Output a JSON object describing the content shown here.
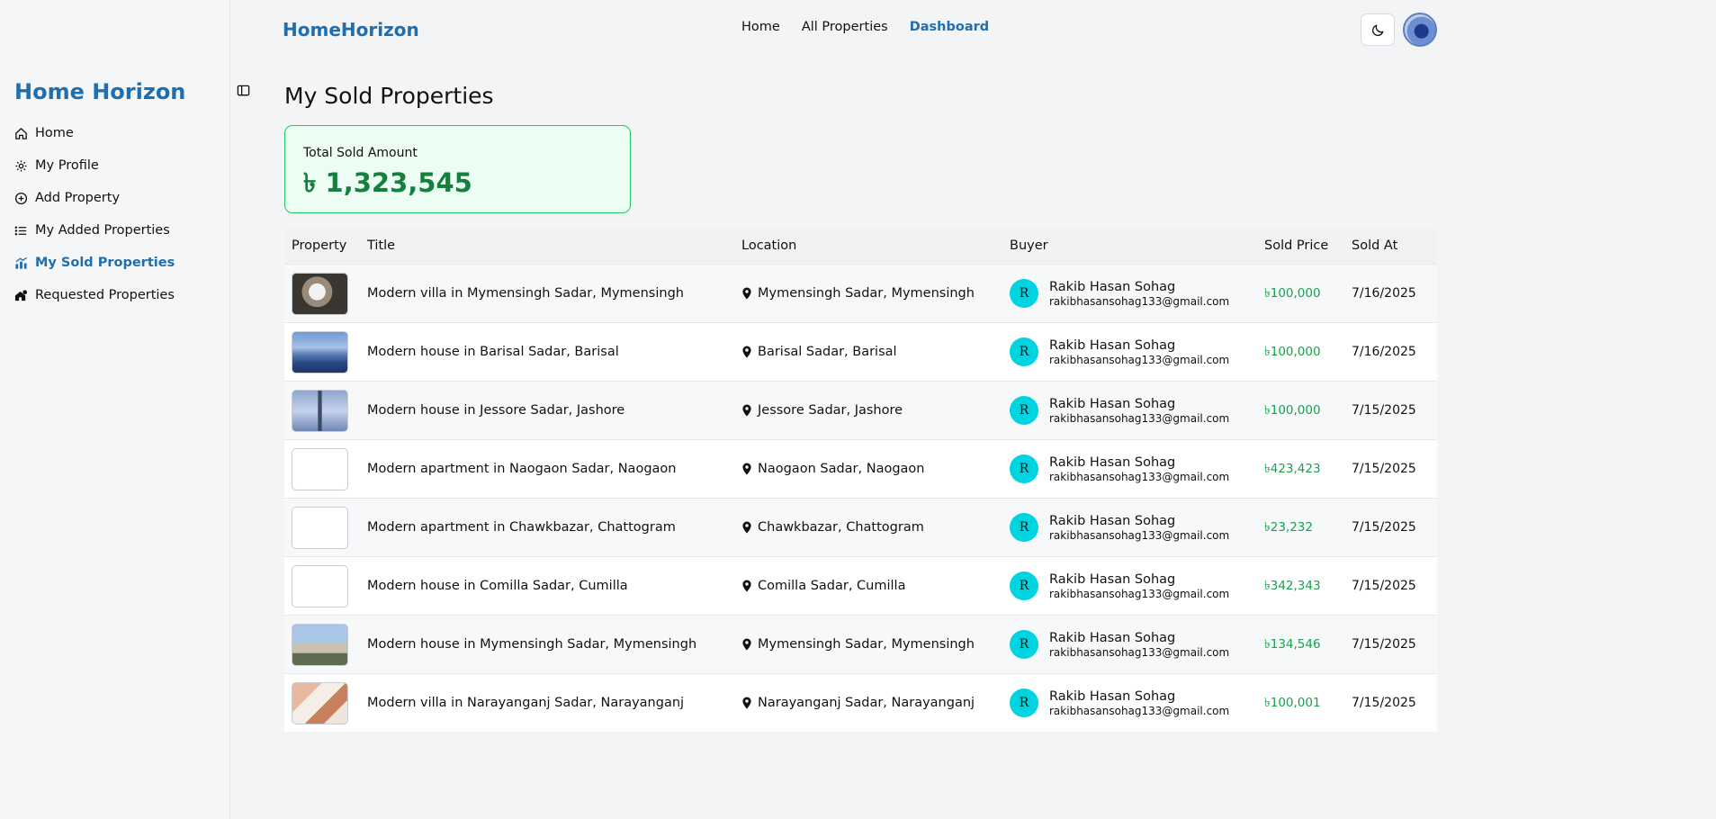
{
  "sidebar": {
    "brand": "Home Horizon",
    "items": [
      {
        "label": "Home",
        "icon": "home-icon",
        "active": false
      },
      {
        "label": "My Profile",
        "icon": "gear-icon",
        "active": false
      },
      {
        "label": "Add Property",
        "icon": "plus-circle-icon",
        "active": false
      },
      {
        "label": "My Added Properties",
        "icon": "list-icon",
        "active": false
      },
      {
        "label": "My Sold Properties",
        "icon": "chart-icon",
        "active": true
      },
      {
        "label": "Requested Properties",
        "icon": "house-request-icon",
        "active": false
      }
    ]
  },
  "header": {
    "brand": "HomeHorizon",
    "nav": [
      "Home",
      "All Properties",
      "Dashboard"
    ],
    "active_nav": "Dashboard"
  },
  "main": {
    "title": "My Sold Properties",
    "summary": {
      "label": "Total Sold Amount",
      "value": "৳ 1,323,545"
    },
    "table": {
      "headers": [
        "Property",
        "Title",
        "Location",
        "Buyer",
        "Sold Price",
        "Sold At"
      ],
      "rows": [
        {
          "title": "Modern villa in Mymensingh Sadar, Mymensingh",
          "location": "Mymensingh Sadar, Mymensingh",
          "buyer_initial": "R",
          "buyer_name": "Rakib Hasan Sohag",
          "buyer_email": "rakibhasansohag133@gmail.com",
          "price": "৳100,000",
          "date": "7/16/2025",
          "thumb": "dog"
        },
        {
          "title": "Modern house in Barisal Sadar, Barisal",
          "location": "Barisal Sadar, Barisal",
          "buyer_initial": "R",
          "buyer_name": "Rakib Hasan Sohag",
          "buyer_email": "rakibhasansohag133@gmail.com",
          "price": "৳100,000",
          "date": "7/16/2025",
          "thumb": "mountains"
        },
        {
          "title": "Modern house in Jessore Sadar, Jashore",
          "location": "Jessore Sadar, Jashore",
          "buyer_initial": "R",
          "buyer_name": "Rakib Hasan Sohag",
          "buyer_email": "rakibhasansohag133@gmail.com",
          "price": "৳100,000",
          "date": "7/15/2025",
          "thumb": "tower"
        },
        {
          "title": "Modern apartment in Naogaon Sadar, Naogaon",
          "location": "Naogaon Sadar, Naogaon",
          "buyer_initial": "R",
          "buyer_name": "Rakib Hasan Sohag",
          "buyer_email": "rakibhasansohag133@gmail.com",
          "price": "৳423,423",
          "date": "7/15/2025",
          "thumb": "blank"
        },
        {
          "title": "Modern apartment in Chawkbazar, Chattogram",
          "location": "Chawkbazar, Chattogram",
          "buyer_initial": "R",
          "buyer_name": "Rakib Hasan Sohag",
          "buyer_email": "rakibhasansohag133@gmail.com",
          "price": "৳23,232",
          "date": "7/15/2025",
          "thumb": "blank"
        },
        {
          "title": "Modern house in Comilla Sadar, Cumilla",
          "location": "Comilla Sadar, Cumilla",
          "buyer_initial": "R",
          "buyer_name": "Rakib Hasan Sohag",
          "buyer_email": "rakibhasansohag133@gmail.com",
          "price": "৳342,343",
          "date": "7/15/2025",
          "thumb": "blank"
        },
        {
          "title": "Modern house in Mymensingh Sadar, Mymensingh",
          "location": "Mymensingh Sadar, Mymensingh",
          "buyer_initial": "R",
          "buyer_name": "Rakib Hasan Sohag",
          "buyer_email": "rakibhasansohag133@gmail.com",
          "price": "৳134,546",
          "date": "7/15/2025",
          "thumb": "buildings"
        },
        {
          "title": "Modern villa in Narayanganj Sadar, Narayanganj",
          "location": "Narayanganj Sadar, Narayanganj",
          "buyer_initial": "R",
          "buyer_name": "Rakib Hasan Sohag",
          "buyer_email": "rakibhasansohag133@gmail.com",
          "price": "৳100,001",
          "date": "7/15/2025",
          "thumb": "interior"
        }
      ]
    }
  },
  "colors": {
    "brand": "#1f6fb0",
    "price": "#16a34a",
    "buyer_avatar": "#00d4e0",
    "card_border": "#22c55e"
  }
}
